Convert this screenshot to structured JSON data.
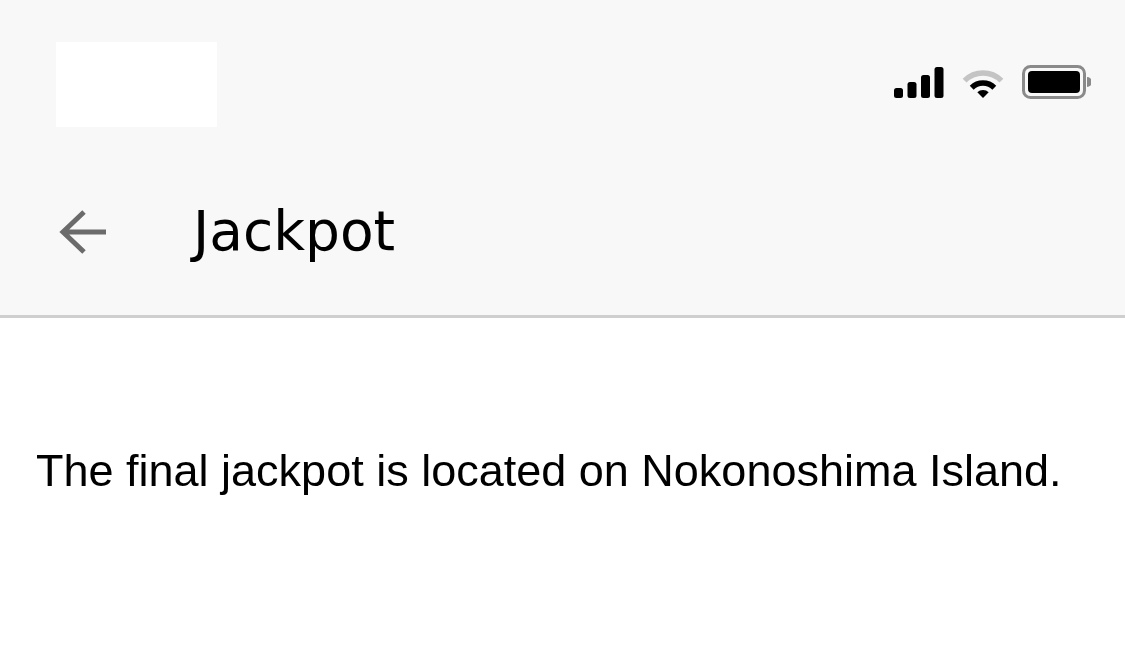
{
  "header": {
    "title": "Jackpot"
  },
  "content": {
    "message": "The final jackpot is located on Nokonoshima Island."
  }
}
